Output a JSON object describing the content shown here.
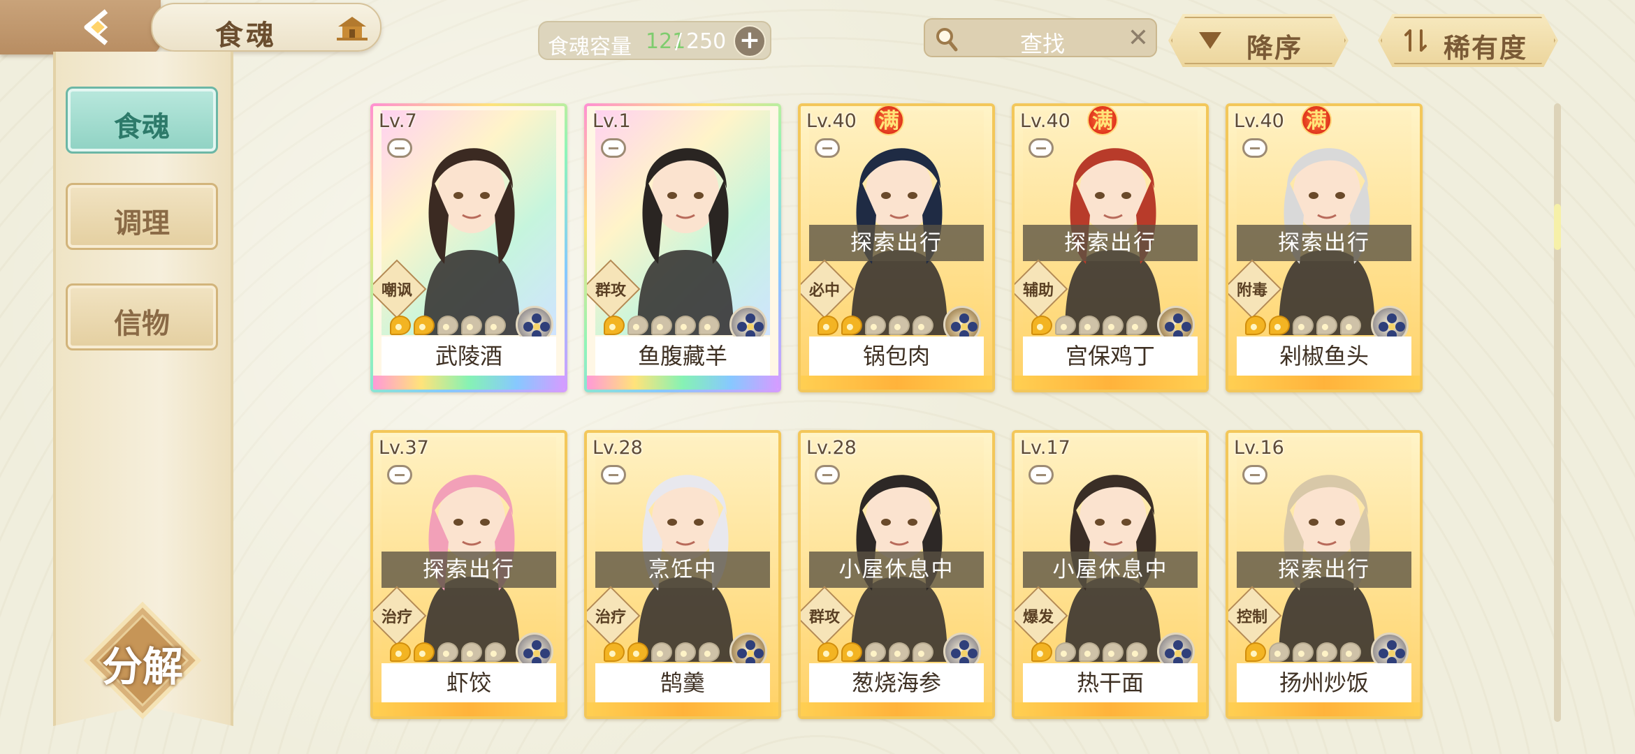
{
  "header": {
    "title": "食魂",
    "capacity_label": "食魂容量",
    "capacity_current": "121",
    "capacity_sep": "/",
    "capacity_max": "250",
    "capacity_plus": "+",
    "search_placeholder": "查找",
    "search_clear": "✕",
    "sort_desc_label": "降序",
    "sort_rarity_label": "稀有度"
  },
  "sidebar": {
    "items": [
      {
        "label": "食魂"
      },
      {
        "label": "调理"
      },
      {
        "label": "信物"
      }
    ],
    "decompose_label": "分解"
  },
  "colors": {
    "accent_teal": "#8fd2c3",
    "card_gold": "#ffd166",
    "capacity_green": "#7ecc6e",
    "full_badge": "#e0341c"
  },
  "cards": [
    {
      "level": "Lv.7",
      "full": "",
      "status": "",
      "tag": "嘲讽",
      "name": "武陵酒",
      "rarity_on": 2,
      "rarity_total": 5,
      "style": "rainbow",
      "element_icon": "flower-icon"
    },
    {
      "level": "Lv.1",
      "full": "",
      "status": "",
      "tag": "群攻",
      "name": "鱼腹藏羊",
      "rarity_on": 1,
      "rarity_total": 5,
      "style": "rainbow",
      "element_icon": "flower-icon"
    },
    {
      "level": "Lv.40",
      "full": "满",
      "status": "探索出行",
      "tag": "必中",
      "name": "锅包肉",
      "rarity_on": 2,
      "rarity_total": 5,
      "style": "gold",
      "element_icon": "flower-icon"
    },
    {
      "level": "Lv.40",
      "full": "满",
      "status": "探索出行",
      "tag": "辅助",
      "name": "宫保鸡丁",
      "rarity_on": 1,
      "rarity_total": 5,
      "style": "gold",
      "element_icon": "flower-icon"
    },
    {
      "level": "Lv.40",
      "full": "满",
      "status": "探索出行",
      "tag": "附毒",
      "name": "剁椒鱼头",
      "rarity_on": 2,
      "rarity_total": 5,
      "style": "gold",
      "element_icon": "flower-icon"
    },
    {
      "level": "Lv.37",
      "full": "",
      "status": "探索出行",
      "tag": "治疗",
      "name": "虾饺",
      "rarity_on": 2,
      "rarity_total": 5,
      "style": "gold",
      "element_icon": "flower-icon"
    },
    {
      "level": "Lv.28",
      "full": "",
      "status": "烹饪中",
      "tag": "治疗",
      "name": "鹄羹",
      "rarity_on": 2,
      "rarity_total": 5,
      "style": "gold",
      "element_icon": "flower-icon"
    },
    {
      "level": "Lv.28",
      "full": "",
      "status": "小屋休息中",
      "tag": "群攻",
      "name": "葱烧海参",
      "rarity_on": 2,
      "rarity_total": 5,
      "style": "gold",
      "element_icon": "flower-icon"
    },
    {
      "level": "Lv.17",
      "full": "",
      "status": "小屋休息中",
      "tag": "爆发",
      "name": "热干面",
      "rarity_on": 1,
      "rarity_total": 5,
      "style": "gold",
      "element_icon": "flower-icon"
    },
    {
      "level": "Lv.16",
      "full": "",
      "status": "探索出行",
      "tag": "控制",
      "name": "扬州炒饭",
      "rarity_on": 1,
      "rarity_total": 5,
      "style": "gold",
      "element_icon": "flower-icon"
    }
  ]
}
